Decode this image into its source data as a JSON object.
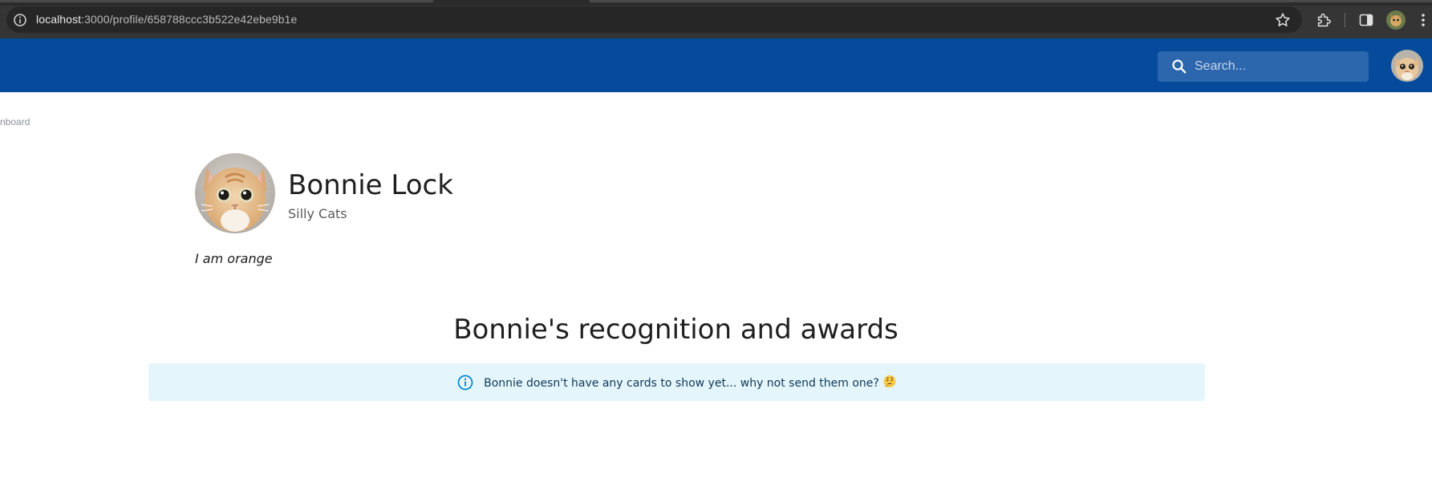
{
  "browser": {
    "url_host": "localhost",
    "url_path": ":3000/profile/658788ccc3b522e42ebe9b1e",
    "icons": [
      "info-icon",
      "star-icon",
      "extension-icon",
      "side-panel-icon",
      "profile-avatar-icon",
      "menu-dots-icon"
    ]
  },
  "header": {
    "background_color": "#054a9b",
    "search_placeholder": "Search...",
    "search_value": ""
  },
  "nav": {
    "back_link_label": "nboard"
  },
  "profile": {
    "name": "Bonnie Lock",
    "team": "Silly Cats",
    "bio": "I am orange"
  },
  "awards": {
    "title": "Bonnie's recognition and awards",
    "empty_message": "Bonnie doesn't have any cards to show yet... why not send them one?",
    "empty_emoji": "thinking-face",
    "alert_color": "#e5f5fc",
    "icon_color": "#0288d1"
  }
}
